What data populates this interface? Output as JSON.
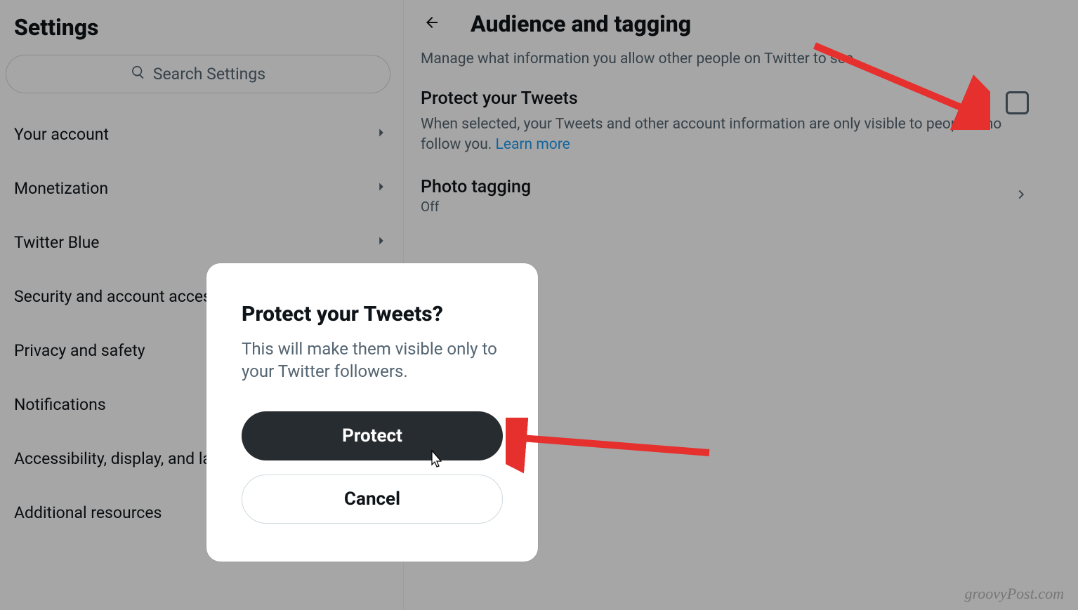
{
  "sidebar": {
    "title": "Settings",
    "search_placeholder": "Search Settings",
    "items": [
      {
        "label": "Your account"
      },
      {
        "label": "Monetization"
      },
      {
        "label": "Twitter Blue"
      },
      {
        "label": "Security and account access"
      },
      {
        "label": "Privacy and safety"
      },
      {
        "label": "Notifications"
      },
      {
        "label": "Accessibility, display, and languages"
      },
      {
        "label": "Additional resources"
      }
    ]
  },
  "detail": {
    "title": "Audience and tagging",
    "description": "Manage what information you allow other people on Twitter to see.",
    "protect": {
      "title": "Protect your Tweets",
      "subtitle": "When selected, your Tweets and other account information are only visible to people who follow you. ",
      "learn_more": "Learn more"
    },
    "photo_tagging": {
      "title": "Photo tagging",
      "value": "Off"
    }
  },
  "modal": {
    "title": "Protect your Tweets?",
    "body": "This will make them visible only to your Twitter followers.",
    "primary_label": "Protect",
    "secondary_label": "Cancel"
  },
  "watermark": "groovyPost.com"
}
